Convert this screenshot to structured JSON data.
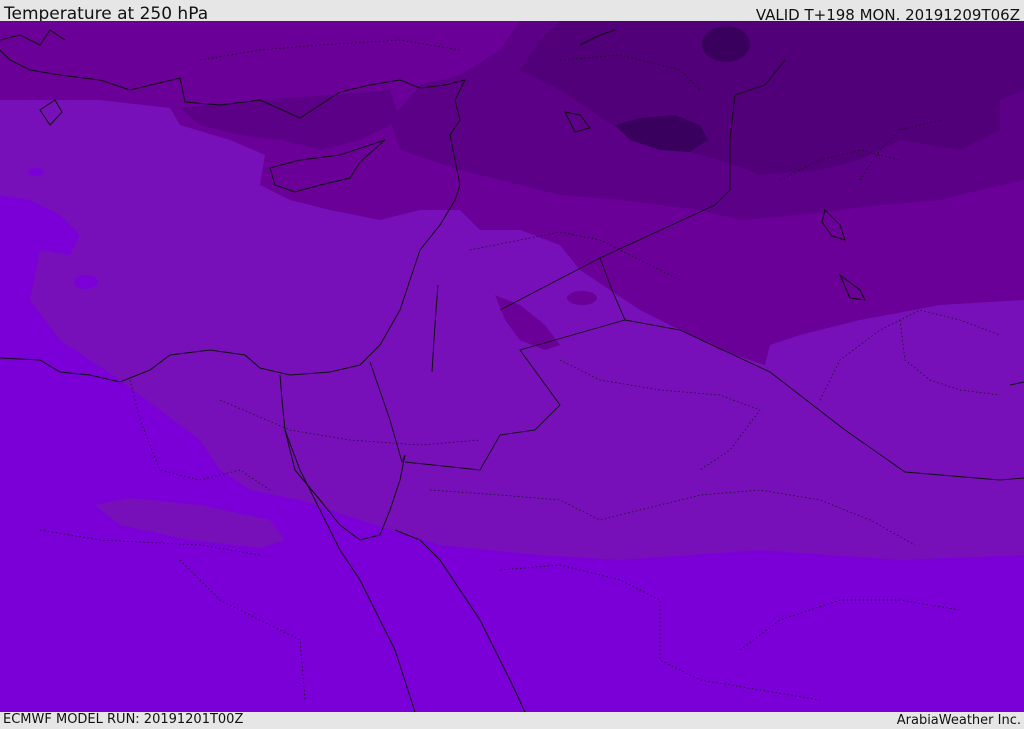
{
  "header": {
    "title": "Temperature at 250 hPa",
    "valid": "VALID T+198 MON. 20191209T06Z"
  },
  "footer": {
    "model_run": "ECMWF MODEL RUN: 20191201T00Z",
    "credit": "ArabiaWeather Inc."
  },
  "colors": {
    "warmest": "#7b00d8",
    "warm": "#7710b8",
    "mid": "#6a0098",
    "cool": "#5c0088",
    "cold": "#52007a",
    "coldest": "#3a005e",
    "coast": "#111111"
  }
}
